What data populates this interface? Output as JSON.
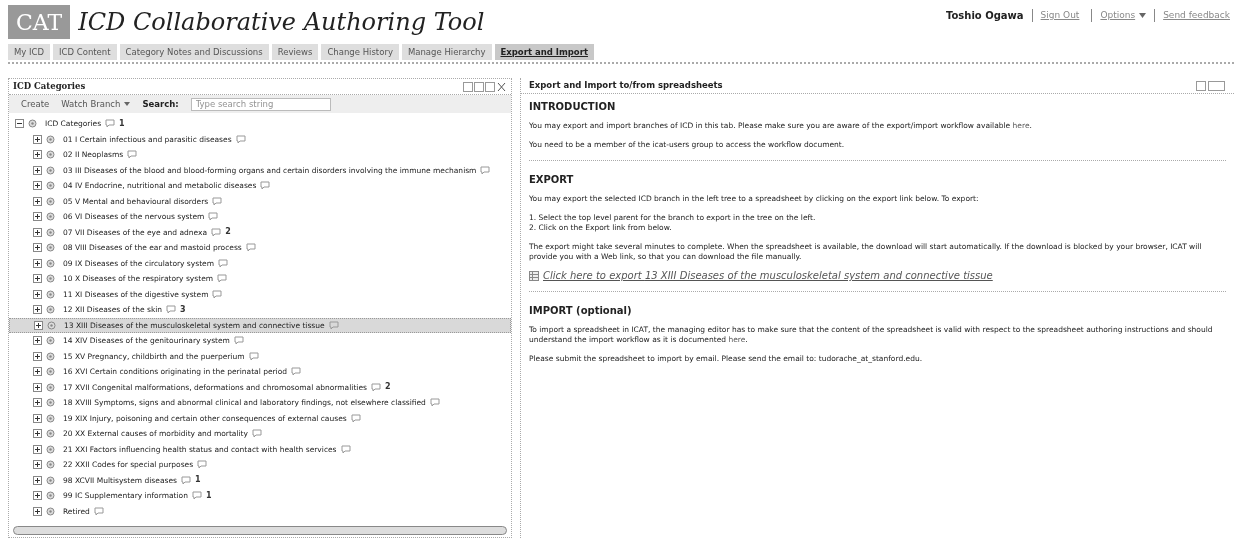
{
  "header": {
    "logo": "CAT",
    "title": "ICD Collaborative Authoring Tool",
    "user": "Toshio Ogawa",
    "links": [
      {
        "label": "Sign Out",
        "dropdown": false
      },
      {
        "label": "Options",
        "dropdown": true
      },
      {
        "label": "Send feedback",
        "dropdown": false
      }
    ]
  },
  "tabs": [
    {
      "label": "My ICD",
      "selected": false
    },
    {
      "label": "ICD Content",
      "selected": false
    },
    {
      "label": "Category Notes and Discussions",
      "selected": false
    },
    {
      "label": "Reviews",
      "selected": false
    },
    {
      "label": "Change History",
      "selected": false
    },
    {
      "label": "Manage Hierarchy",
      "selected": false
    },
    {
      "label": "Export and Import",
      "selected": true
    }
  ],
  "left_panel": {
    "title": "ICD Categories",
    "toolbar": {
      "create": "Create",
      "watch": "Watch Branch",
      "search_label": "Search:",
      "search_placeholder": "Type search string"
    },
    "tree": {
      "label": "ICD Categories",
      "notes": "1",
      "expanded": true,
      "selected": false,
      "children": [
        {
          "label": "01 I Certain infectious and parasitic diseases",
          "selected": false
        },
        {
          "label": "02 II Neoplasms",
          "selected": false
        },
        {
          "label": "03 III Diseases of the blood and blood-forming organs and certain disorders involving the immune mechanism",
          "selected": false
        },
        {
          "label": "04 IV Endocrine, nutritional and metabolic diseases",
          "selected": false
        },
        {
          "label": "05 V Mental and behavioural disorders",
          "selected": false
        },
        {
          "label": "06 VI Diseases of the nervous system",
          "selected": false
        },
        {
          "label": "07 VII Diseases of the eye and adnexa",
          "notes": "2",
          "selected": false
        },
        {
          "label": "08 VIII Diseases of the ear and mastoid process",
          "selected": false
        },
        {
          "label": "09 IX Diseases of the circulatory system",
          "selected": false
        },
        {
          "label": "10 X Diseases of the respiratory system",
          "selected": false
        },
        {
          "label": "11 XI Diseases of the digestive system",
          "selected": false
        },
        {
          "label": "12 XII Diseases of the skin",
          "notes": "3",
          "selected": false
        },
        {
          "label": "13 XIII Diseases of the musculoskeletal system and connective tissue",
          "selected": true
        },
        {
          "label": "14 XIV Diseases of the genitourinary system",
          "selected": false
        },
        {
          "label": "15 XV Pregnancy, childbirth and the puerperium",
          "selected": false
        },
        {
          "label": "16 XVI Certain conditions originating in the perinatal period",
          "selected": false
        },
        {
          "label": "17 XVII Congenital malformations, deformations and chromosomal abnormalities",
          "notes": "2",
          "selected": false
        },
        {
          "label": "18 XVIII Symptoms, signs and abnormal clinical and laboratory findings, not elsewhere classified",
          "selected": false
        },
        {
          "label": "19 XIX Injury, poisoning and certain other consequences of external causes",
          "selected": false
        },
        {
          "label": "20 XX External causes of morbidity and mortality",
          "selected": false
        },
        {
          "label": "21 XXI Factors influencing health status and contact with health services",
          "selected": false
        },
        {
          "label": "22 XXII Codes for special purposes",
          "selected": false
        },
        {
          "label": "98 XCVII Multisystem diseases",
          "notes": "1",
          "selected": false
        },
        {
          "label": "99 IC Supplementary information",
          "notes": "1",
          "selected": false
        },
        {
          "label": "Retired",
          "selected": false
        }
      ]
    }
  },
  "right_panel": {
    "title": "Export and Import to/from spreadsheets",
    "sections": [
      {
        "heading": "INTRODUCTION",
        "paragraphs": [
          {
            "text": "You may export and import branches of ICD in this tab. Please make sure you are aware of the export/import workflow available ",
            "link": "here",
            "after": "."
          },
          {
            "text": "You need to be a member of the icat-users group to access the workflow document."
          }
        ]
      },
      {
        "heading": "EXPORT",
        "paragraphs": [
          {
            "text": "You may export the selected ICD branch in the left tree to a spreadsheet by clicking on the export link below. To export:"
          },
          {
            "lines": [
              "1. Select the top level parent for the branch to export in the tree on the left.",
              "2. Click on the Export link from below."
            ]
          },
          {
            "text": "The export might take several minutes to complete. When the spreadsheet is available, the download will start automatically. If the download is blocked by your browser, ICAT will provide you with a Web link, so that you can download the file manually."
          }
        ],
        "export_link": "Click here to export *13 XIII Diseases of the musculoskeletal system and connective tissue*"
      },
      {
        "heading": "IMPORT (optional)",
        "paragraphs": [
          {
            "text": "To import a spreadsheet in ICAT, the managing editor has to make sure that the content of the spreadsheet is valid with respect to the spreadsheet authoring instructions and should understand the import workflow as it is documented ",
            "link": "here",
            "after": "."
          },
          {
            "text": "Please submit the spreadsheet to import by email. Please send the email to: tudorache_at_stanford.edu."
          }
        ]
      }
    ]
  }
}
